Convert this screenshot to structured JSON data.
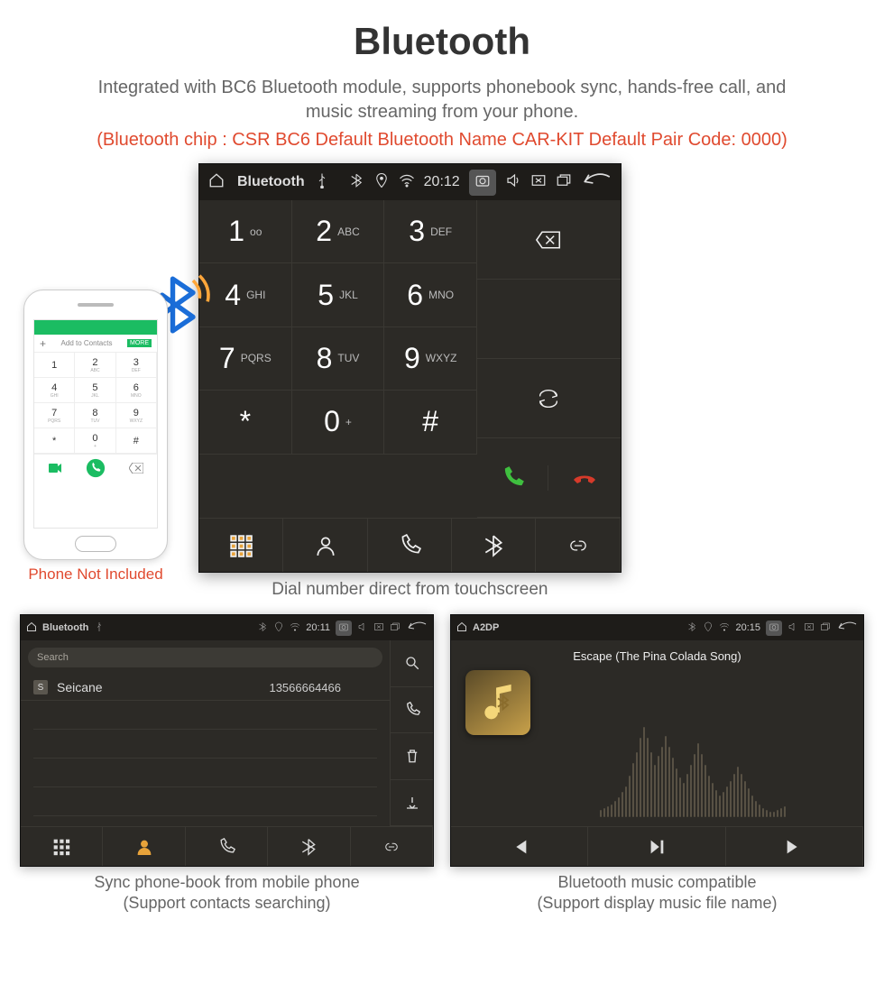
{
  "page": {
    "title": "Bluetooth",
    "description": "Integrated with BC6 Bluetooth module, supports phonebook sync, hands-free call, and music streaming from your phone.",
    "spec": "(Bluetooth chip : CSR BC6     Default Bluetooth Name CAR-KIT     Default Pair Code: 0000)"
  },
  "phone": {
    "caption": "Phone Not Included",
    "add_contacts": "Add to Contacts",
    "more": "MORE",
    "keys": [
      {
        "d": "1",
        "s": ""
      },
      {
        "d": "2",
        "s": "ABC"
      },
      {
        "d": "3",
        "s": "DEF"
      },
      {
        "d": "4",
        "s": "GHI"
      },
      {
        "d": "5",
        "s": "JKL"
      },
      {
        "d": "6",
        "s": "MNO"
      },
      {
        "d": "7",
        "s": "PQRS"
      },
      {
        "d": "8",
        "s": "TUV"
      },
      {
        "d": "9",
        "s": "WXYZ"
      },
      {
        "d": "*",
        "s": ""
      },
      {
        "d": "0",
        "s": "+"
      },
      {
        "d": "#",
        "s": ""
      }
    ]
  },
  "headunit": {
    "status": {
      "title": "Bluetooth",
      "time": "20:12"
    },
    "caption": "Dial number direct from touchscreen",
    "keys": [
      {
        "digit": "1",
        "sub": "oo"
      },
      {
        "digit": "2",
        "sub": "ABC"
      },
      {
        "digit": "3",
        "sub": "DEF"
      },
      {
        "digit": "4",
        "sub": "GHI"
      },
      {
        "digit": "5",
        "sub": "JKL"
      },
      {
        "digit": "6",
        "sub": "MNO"
      },
      {
        "digit": "7",
        "sub": "PQRS"
      },
      {
        "digit": "8",
        "sub": "TUV"
      },
      {
        "digit": "9",
        "sub": "WXYZ"
      },
      {
        "digit": "*",
        "sub": ""
      },
      {
        "digit": "0",
        "sub": "+"
      },
      {
        "digit": "#",
        "sub": ""
      }
    ]
  },
  "phonebook": {
    "status": {
      "title": "Bluetooth",
      "time": "20:11"
    },
    "search_placeholder": "Search",
    "contact": {
      "badge": "S",
      "name": "Seicane",
      "number": "13566664466"
    },
    "caption_line1": "Sync phone-book from mobile phone",
    "caption_line2": "(Support contacts searching)"
  },
  "music": {
    "status": {
      "title": "A2DP",
      "time": "20:15"
    },
    "now_playing": "Escape (The Pina Colada Song)",
    "caption_line1": "Bluetooth music compatible",
    "caption_line2": "(Support display music file name)"
  }
}
